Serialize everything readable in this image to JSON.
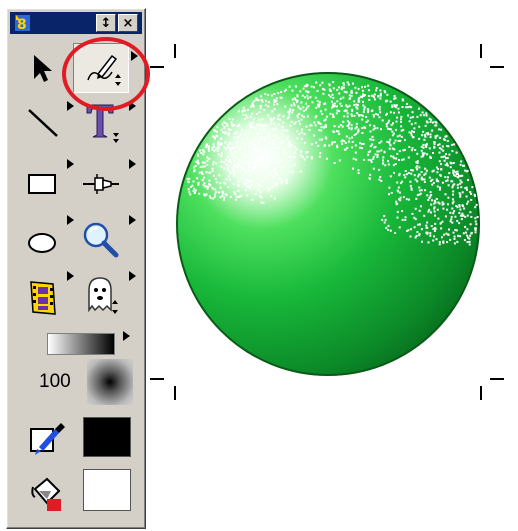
{
  "palette": {
    "close_glyph": "×",
    "dock_glyph": "↕",
    "tools": [
      {
        "name": "pointer-tool",
        "icon": "arrow-pointer-icon"
      },
      {
        "name": "pencil-tool",
        "icon": "pencil-icon",
        "selected": true
      },
      {
        "name": "line-tool",
        "icon": "line-icon"
      },
      {
        "name": "text-tool",
        "icon": "text-t-icon"
      },
      {
        "name": "rectangle-tool",
        "icon": "rectangle-icon"
      },
      {
        "name": "connector-tool",
        "icon": "plug-icon"
      },
      {
        "name": "ellipse-tool",
        "icon": "ellipse-icon"
      },
      {
        "name": "zoom-tool",
        "icon": "magnifier-icon"
      },
      {
        "name": "film-tool",
        "icon": "film-strip-icon"
      },
      {
        "name": "ghost-tool",
        "icon": "ghost-icon"
      }
    ],
    "opacity_value": "100",
    "colors": {
      "accent_highlight": "#e01b24",
      "titlebar": "#0a246a",
      "line_color": "#000000",
      "fill_color": "#ffffff",
      "sphere_light": "#ffffff",
      "sphere_mid": "#22cc44",
      "sphere_dark": "#0a7a20"
    }
  }
}
